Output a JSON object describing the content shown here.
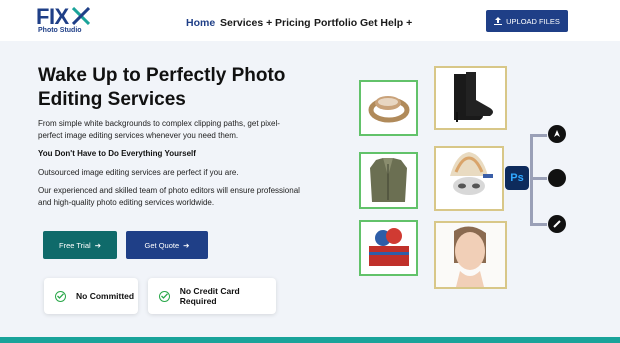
{
  "header": {
    "logo_text": "FIX",
    "logo_sub": "Photo Studio",
    "nav": [
      {
        "label": "Home",
        "active": true
      },
      {
        "label": "Services +"
      },
      {
        "label": "Pricing"
      },
      {
        "label": "Portfolio"
      },
      {
        "label": "Get Help +"
      }
    ],
    "upload_label": "UPLOAD FILES"
  },
  "hero": {
    "title": "Wake Up to Perfectly Photo Editing Services",
    "para1": "From simple white backgrounds to complex clipping paths, get pixel-perfect image editing services whenever you need them.",
    "para2": "You Don't Have to Do Everything Yourself",
    "para3": "Outsourced image editing services are perfect if you are.",
    "para4": "Our experienced and skilled team of photo editors will ensure professional and high-quality photo editing services worldwide.",
    "btn_trial": "Free Trial",
    "btn_quote": "Get Quote",
    "features": [
      "No Committed",
      "No Credit Card Required"
    ]
  },
  "gallery": {
    "ps_label": "Ps"
  },
  "colors": {
    "brand": "#1f3f87",
    "teal": "#0f6a6a",
    "green": "#62c26a",
    "gold": "#d8c788"
  }
}
